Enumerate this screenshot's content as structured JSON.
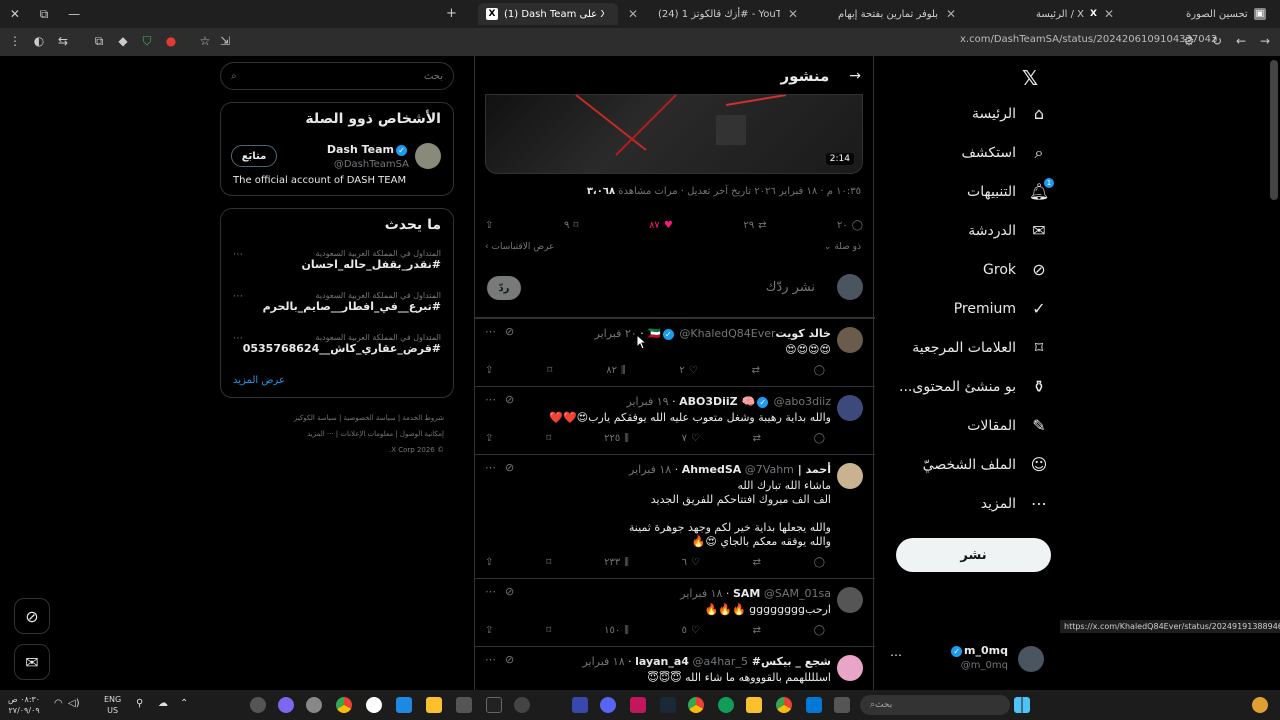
{
  "browser": {
    "tabs": [
      {
        "label": "تحسين الصورة",
        "active": false
      },
      {
        "label": "الرئيسة / X",
        "active": false
      },
      {
        "label": "بلوفر تمارين بفتحة إبهام",
        "active": false
      },
      {
        "label": "(24) أزك قالكوتز 1# - YouTube",
        "active": false
      },
      {
        "label": "(1) Dash Team على X: \"ل الهدف",
        "active": true
      }
    ],
    "url": "x.com/DashTeamSA/status/2024206109104337042",
    "status_url": "https://x.com/KhaledQ84Ever/status/2024919138894660395"
  },
  "nav": {
    "items": [
      {
        "label": "الرئيسة",
        "icon": "home-icon"
      },
      {
        "label": "استكشف",
        "icon": "search-icon"
      },
      {
        "label": "التنبيهات",
        "icon": "bell-icon",
        "badge": "1"
      },
      {
        "label": "الدردشة",
        "icon": "mail-icon"
      },
      {
        "label": "Grok",
        "icon": "grok-icon"
      },
      {
        "label": "Premium",
        "icon": "premium-icon"
      },
      {
        "label": "العلامات المرجعية",
        "icon": "bookmark-icon"
      },
      {
        "label": "...بو منشئ المحتوى",
        "icon": "creator-icon"
      },
      {
        "label": "المقالات",
        "icon": "articles-icon"
      },
      {
        "label": "الملف الشخصيّ",
        "icon": "profile-icon"
      },
      {
        "label": "المزيد",
        "icon": "more-icon"
      }
    ],
    "post_button": "نشر",
    "account": {
      "name": "m_0mq",
      "handle": "@m_0mq"
    }
  },
  "main": {
    "header_title": "منشور",
    "video_duration": "2:14",
    "meta_text": "١٠:٣٥ م · ١٨ فبراير ٢٠٢٦ تاريخ آخر تعديل · مرات مشاهدة",
    "views": "٣،٠٦٨",
    "stats": {
      "replies": "٢٠",
      "retweets": "٢٩",
      "likes": "٨٧",
      "bookmarks": "٩"
    },
    "related_label": "ذو صلة",
    "quotes_label": "عرض الاقتباسات",
    "reply_placeholder": "نشر ردّك",
    "reply_button": "ردّ",
    "replies": [
      {
        "name": "خالد كويت🇰🇼",
        "handle": "@KhaledQ84Ever",
        "time": "٢٠ فبراير",
        "lines": [
          "😍😍😍😍"
        ],
        "stats": {
          "replies": "",
          "retweets": "",
          "likes": "٢",
          "views": "٨٢"
        }
      },
      {
        "name": "ABO3DiiZ 🧠",
        "handle": "@abo3diiz",
        "time": "١٩ فبراير",
        "lines": [
          "والله بداية رهيبة وشغل متعوب عليه الله يوفقكم يارب😍❤️❤️"
        ],
        "stats": {
          "replies": "",
          "retweets": "",
          "likes": "٧",
          "views": "٢٢٥"
        }
      },
      {
        "name": "أحمد | AhmedSA",
        "handle": "@7Vahm",
        "time": "١٨ فبراير",
        "lines": [
          "ماشاء الله تبارك الله",
          "الف الف مبروك افتتاحكم للفريق الجديد",
          "",
          "والله يجعلها بداية خير لكم وجهد جوهرة ثمينة",
          "والله يوفقه معكم بالجاي 😍🔥"
        ],
        "stats": {
          "replies": "",
          "retweets": "",
          "likes": "٦",
          "views": "٢٣٣"
        }
      },
      {
        "name": "SAM",
        "handle": "@SAM_01sa",
        "time": "١٨ فبراير",
        "lines": [
          "ارحبgggggggg 🔥🔥🔥"
        ],
        "stats": {
          "replies": "",
          "retweets": "",
          "likes": "٥",
          "views": "١٥٠"
        }
      },
      {
        "name": "شجع _ بيكس# layan_a4",
        "handle": "@a4har_5",
        "time": "١٨ فبراير",
        "lines": [
          "اسللللهمم بالقوووهه ما شاء الله 😇😇😇"
        ],
        "stats": {
          "replies": "",
          "retweets": "",
          "likes": "",
          "views": ""
        }
      }
    ]
  },
  "right": {
    "search_placeholder": "بحث",
    "related_title": "الأشخاص ذوو الصلة",
    "related_person": {
      "name": "Dash Team",
      "handle": "@DashTeamSA",
      "bio": "The official account of DASH TEAM",
      "follow": "متابَع"
    },
    "trends_title": "ما يحدث",
    "trends": [
      {
        "category": "المتداول في المملكة العربية السعودية",
        "tag": "#نقدر_بقفل_حاله_احسان"
      },
      {
        "category": "المتداول في المملكة العربية السعودية",
        "tag": "#تبرع__في_افطار__صايم_بالحرم"
      },
      {
        "category": "المتداول في المملكة العربية السعودية",
        "tag": "#قرض_عقاري_كاش__0535768624"
      }
    ],
    "show_more": "عرض المزيد",
    "footer": [
      "شروط الخدمة",
      "سياسة الخصوصية",
      "سياسة الكوكيز",
      "إمكانية الوصول",
      "معلومات الإعلانات",
      "··· المزيد",
      "© 2026 X Corp."
    ]
  },
  "taskbar": {
    "time": "٠٨:٣٠ ص",
    "date": "٢٧/٠٩/٠٩",
    "lang": "ENG",
    "region": "US",
    "search": "بحث"
  },
  "colors": {
    "accent": "#1d9bf0",
    "like": "#f91880",
    "bg": "#000000",
    "border": "#2f3336"
  }
}
